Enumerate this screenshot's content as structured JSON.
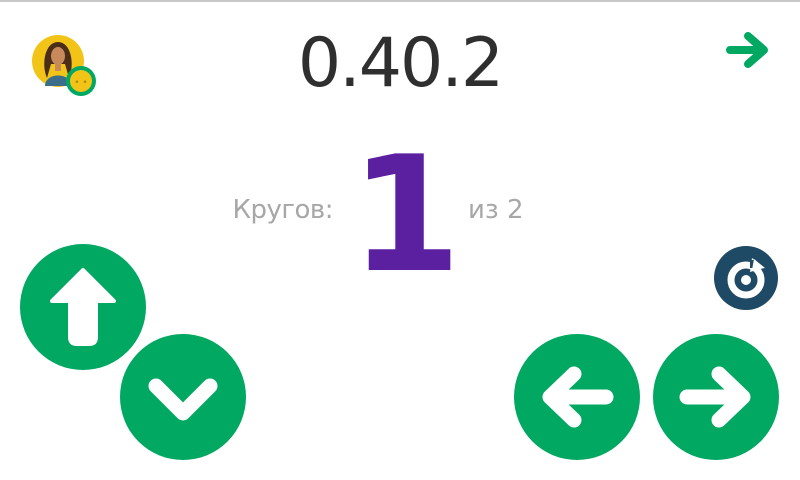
{
  "hud": {
    "timer": "0.40.2",
    "laps_label": "Кругов:",
    "laps_current": "1",
    "laps_total": "из 2"
  },
  "icons": {
    "avatar": "player-avatar",
    "next": "arrow-right-icon",
    "restart": "restart-icon",
    "up": "arrow-up-icon",
    "down": "chevron-down-icon",
    "left": "arrow-left-icon",
    "right": "arrow-right-icon"
  },
  "colors": {
    "accent_green": "#00a862",
    "lap_purple": "#5a20a0",
    "restart_navy": "#1f4a66",
    "avatar_yellow": "#f2c418"
  }
}
